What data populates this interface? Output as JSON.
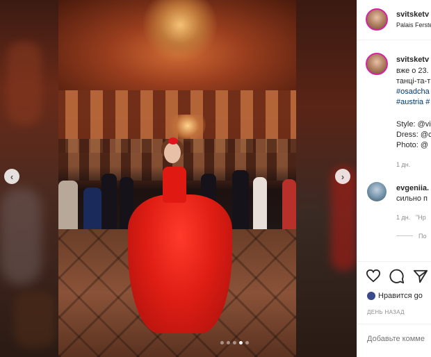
{
  "post": {
    "username": "svitsketv",
    "location": "Palais Ferste",
    "caption_lines": [
      "вже о 23.",
      "танці-та-т",
      "#osadcha",
      "#austria #"
    ],
    "credits": [
      "Style: @vi",
      "Dress: @c",
      "Photo: @"
    ],
    "posted_ago": "1 дн."
  },
  "comment": {
    "username": "evgeniia.",
    "text": "сильно п",
    "time": "1 дн.",
    "reply_label": "\"Нр",
    "view_replies": "По"
  },
  "actions": {
    "likes_text": "Нравится go",
    "date_label": "ДЕНЬ НАЗАД",
    "comment_placeholder": "Добавьте комме"
  },
  "carousel": {
    "dots_total": 5,
    "active_index": 3,
    "prev_glyph": "‹",
    "next_glyph": "›"
  },
  "colors": {
    "hashtag": "#00376b",
    "ring": "#d6249f",
    "muted": "#8e8e8e"
  }
}
